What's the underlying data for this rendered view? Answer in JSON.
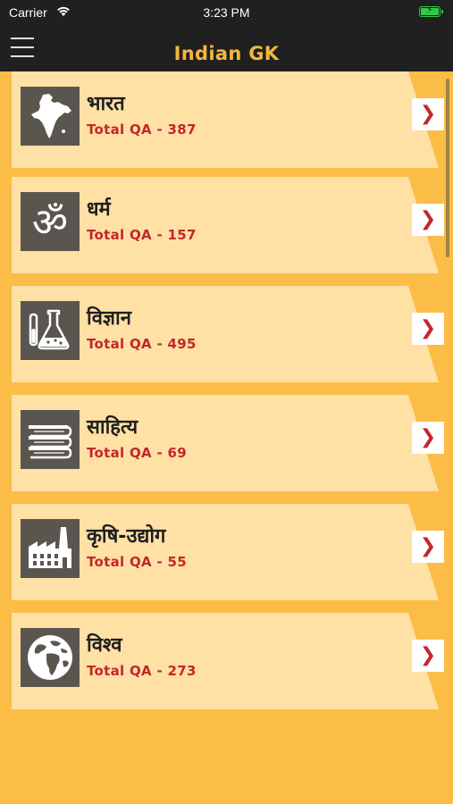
{
  "status_bar": {
    "carrier": "Carrier",
    "time": "3:23 PM"
  },
  "header": {
    "title": "Indian GK"
  },
  "categories": [
    {
      "label": "भारत",
      "count": "Total QA - 387",
      "icon": "india-map-icon"
    },
    {
      "label": "धर्म",
      "count": "Total QA - 157",
      "icon": "om-icon"
    },
    {
      "label": "विज्ञान",
      "count": "Total QA - 495",
      "icon": "lab-flask-icon"
    },
    {
      "label": "साहित्य",
      "count": "Total QA - 69",
      "icon": "books-icon"
    },
    {
      "label": "कृषि-उद्योग",
      "count": "Total QA - 55",
      "icon": "factory-icon"
    },
    {
      "label": "विश्व",
      "count": "Total QA - 273",
      "icon": "globe-icon"
    }
  ],
  "colors": {
    "accent": "#fbbd45",
    "card": "#ffe0a5",
    "count_text": "#c3272b",
    "header_bg": "#202020",
    "title": "#f4b63f"
  }
}
